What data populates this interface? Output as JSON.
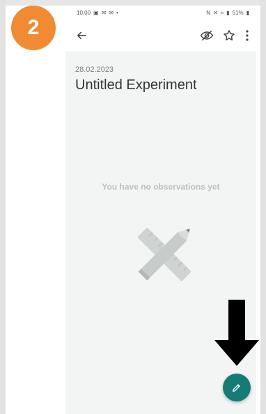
{
  "step_badge": {
    "number": "2",
    "color": "#f08b34"
  },
  "status_bar": {
    "time": "10:00",
    "left_icons": [
      "calendar-icon",
      "mail-icon",
      "mail-icon",
      "dot-icon"
    ],
    "battery": "51%"
  },
  "app_bar": {
    "back_icon": "arrow-left-icon",
    "actions": [
      "visibility-off-icon",
      "star-outline-icon",
      "more-vertical-icon"
    ]
  },
  "experiment": {
    "date": "28.02.2023",
    "title": "Untitled Experiment"
  },
  "empty_state": {
    "message": "You have no observations yet",
    "illustration": "pencil-ruler-icon"
  },
  "fab": {
    "icon": "pencil-icon",
    "color": "#167a76"
  },
  "annotation": {
    "arrow_icon": "arrow-down-icon",
    "color": "#000000"
  }
}
